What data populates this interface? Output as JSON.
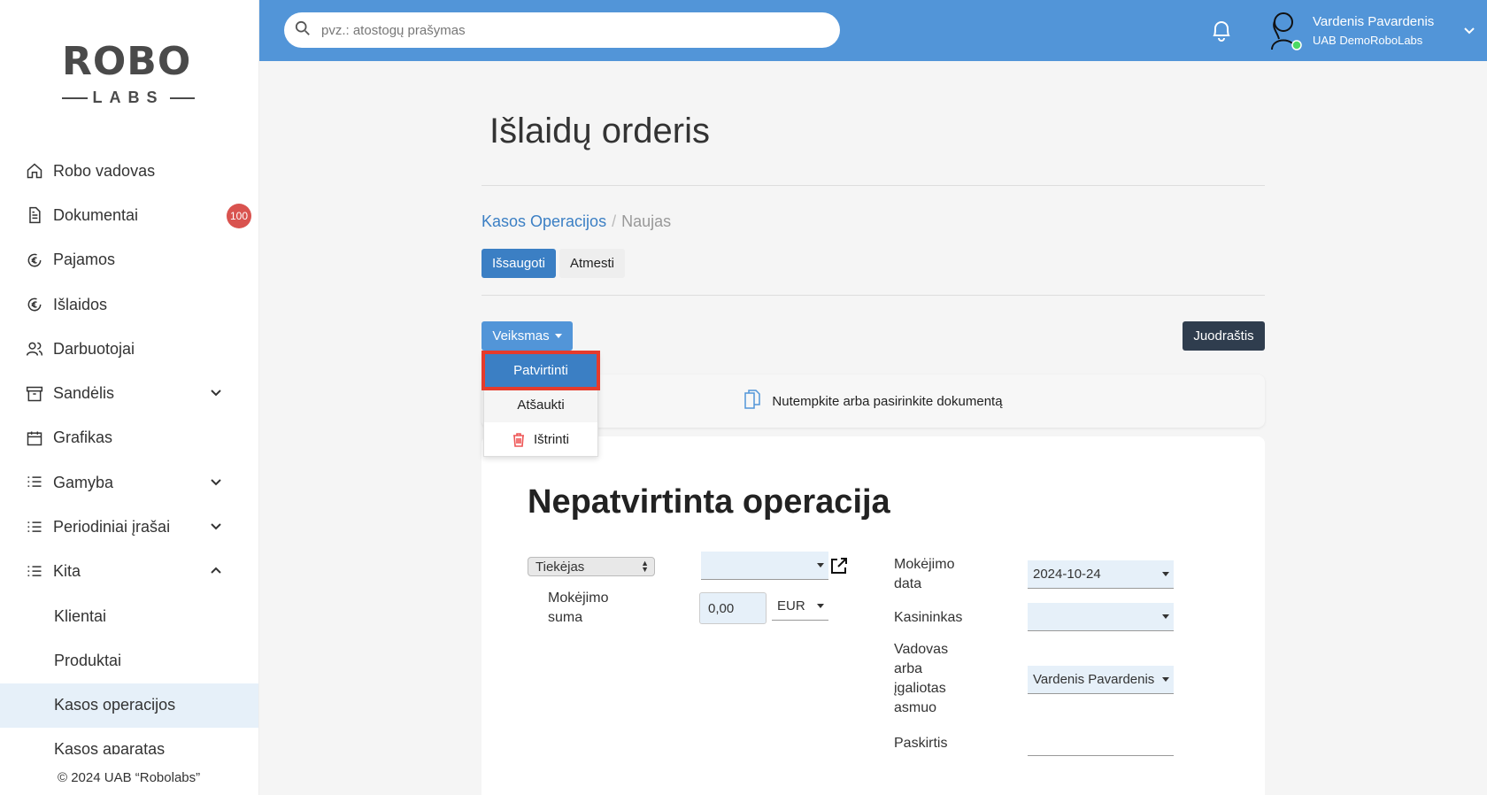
{
  "brand": {
    "logo_main": "ROBO",
    "logo_sub": "LABS"
  },
  "sidebar": {
    "items": [
      {
        "label": "Robo vadovas",
        "icon": "home-icon"
      },
      {
        "label": "Dokumentai",
        "icon": "document-icon",
        "badge": "100"
      },
      {
        "label": "Pajamos",
        "icon": "euro-circle-icon"
      },
      {
        "label": "Išlaidos",
        "icon": "euro-circle-icon"
      },
      {
        "label": "Darbuotojai",
        "icon": "users-icon"
      },
      {
        "label": "Sandėlis",
        "icon": "archive-icon",
        "expand": "chevron-down-icon"
      },
      {
        "label": "Grafikas",
        "icon": "calendar-icon"
      },
      {
        "label": "Gamyba",
        "icon": "list-icon",
        "expand": "chevron-down-icon"
      },
      {
        "label": "Periodiniai įrašai",
        "icon": "list-icon",
        "expand": "chevron-down-icon"
      },
      {
        "label": "Kita",
        "icon": "list-icon",
        "expand": "chevron-up-icon"
      }
    ],
    "sub_items": [
      {
        "label": "Klientai"
      },
      {
        "label": "Produktai"
      },
      {
        "label": "Kasos operacijos",
        "active": true
      },
      {
        "label": "Kasos aparatas"
      }
    ],
    "copyright": "© 2024 UAB “Robolabs”"
  },
  "header": {
    "search_placeholder": "pvz.: atostogų prašymas",
    "user_name": "Vardenis Pavardenis",
    "user_company": "UAB DemoRoboLabs"
  },
  "main": {
    "title": "Išlaidų orderis",
    "breadcrumb": {
      "parent": "Kasos Operacijos",
      "separator": "/",
      "current": "Naujas"
    },
    "save_label": "Išsaugoti",
    "discard_label": "Atmesti",
    "action_label": "Veiksmas",
    "draft_label": "Juodraštis",
    "dropzone_text": "Nutempkite arba pasirinkite dokumentą",
    "dropdown": {
      "confirm": "Patvirtinti",
      "cancel": "Atšaukti",
      "delete": "Ištrinti"
    },
    "form": {
      "title": "Nepatvirtinta operacija",
      "partner_type": "Tiekėjas",
      "partner_value": "",
      "amount_label_1": "Mokėjimo",
      "amount_label_2": "suma",
      "amount_value": "0,00",
      "currency": "EUR",
      "date_label_1": "Mokėjimo",
      "date_label_2": "data",
      "date_value": "2024-10-24",
      "cashier_label": "Kasininkas",
      "cashier_value": "",
      "manager_label_1": "Vadovas",
      "manager_label_2": "arba",
      "manager_label_3": "įgaliotas",
      "manager_label_4": "asmuo",
      "manager_value": "Vardenis Pavardenis",
      "purpose_label": "Paskirtis"
    }
  },
  "colors": {
    "header": "#5295d8",
    "primary": "#3b7fc4",
    "dark": "#2f3d4e",
    "highlight": "#e53b2c",
    "badge": "#d9534f"
  }
}
